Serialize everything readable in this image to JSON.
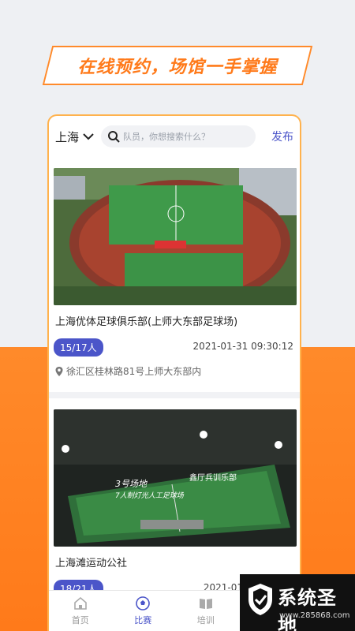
{
  "banner": {
    "text": "在线预约，场馆一手掌握"
  },
  "topbar": {
    "city": "上海",
    "search_placeholder": "队员，你想搜索什么？",
    "publish": "发布"
  },
  "cards": [
    {
      "title": "上海优体足球俱乐部(上师大东部足球场)",
      "count": "15/17人",
      "time": "2021-01-31 09:30:12",
      "address": "徐汇区桂林路81号上师大东部内"
    },
    {
      "title": "上海滩运动公社",
      "count": "18/21人",
      "time": "2021-01",
      "image_text_1": "3号场地",
      "image_text_2": "7人制灯光人工足球场",
      "image_text_3": "鑫厅兵训乐部"
    }
  ],
  "tabbar": {
    "items": [
      {
        "label": "首页",
        "icon": "home-icon"
      },
      {
        "label": "比赛",
        "icon": "soccer-ball-icon"
      },
      {
        "label": "培训",
        "icon": "book-icon"
      },
      {
        "label": "",
        "icon": "user-icon"
      }
    ]
  },
  "watermark": {
    "title": "系统圣地",
    "url": "www.285868.com"
  },
  "colors": {
    "accent": "#4b55c9",
    "orange": "#ff7a1a"
  }
}
